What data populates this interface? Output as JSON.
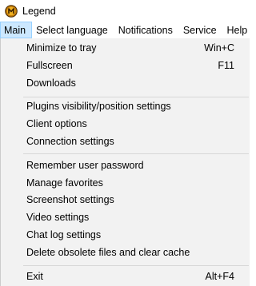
{
  "window": {
    "title": "Legend",
    "icon": "legend-app-icon"
  },
  "menubar": {
    "items": [
      "Main",
      "Select language",
      "Notifications",
      "Service",
      "Help"
    ],
    "active": "Main"
  },
  "dropdown": {
    "groups": [
      [
        {
          "label": "Minimize to tray",
          "shortcut": "Win+C"
        },
        {
          "label": "Fullscreen",
          "shortcut": "F11"
        },
        {
          "label": "Downloads"
        }
      ],
      [
        {
          "label": "Plugins visibility/position settings"
        },
        {
          "label": "Client options"
        },
        {
          "label": "Connection settings"
        }
      ],
      [
        {
          "label": "Remember user password"
        },
        {
          "label": "Manage favorites"
        },
        {
          "label": "Screenshot settings"
        },
        {
          "label": "Video settings"
        },
        {
          "label": "Chat log settings"
        },
        {
          "label": "Delete obsolete files and clear cache"
        }
      ],
      [
        {
          "label": "Exit",
          "shortcut": "Alt+F4"
        }
      ]
    ]
  },
  "colors": {
    "menu_background": "#f2f2f2",
    "active_highlight": "#cce8ff",
    "active_border": "#99d1ff",
    "separator": "#d7d7d7"
  }
}
